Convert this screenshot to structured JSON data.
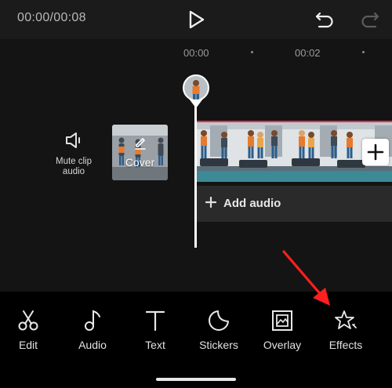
{
  "topbar": {
    "timecode": "00:00/00:08",
    "play_icon": "play-icon",
    "undo_icon": "undo-icon",
    "redo_icon": "redo-icon"
  },
  "ruler": {
    "marks": [
      "00:00",
      "00:02"
    ]
  },
  "track_area": {
    "mute_label": "Mute clip audio",
    "mute_icon": "speaker-icon",
    "cover_label": "Cover",
    "cover_icon": "pencil-icon",
    "add_clip_icon": "plus-icon",
    "add_audio_label": "Add audio"
  },
  "tools": [
    {
      "label": "Edit",
      "icon": "scissors-icon"
    },
    {
      "label": "Audio",
      "icon": "music-note-icon"
    },
    {
      "label": "Text",
      "icon": "text-icon"
    },
    {
      "label": "Stickers",
      "icon": "sticker-icon"
    },
    {
      "label": "Overlay",
      "icon": "overlay-icon"
    },
    {
      "label": "Effects",
      "icon": "effects-star-icon"
    }
  ],
  "colors": {
    "background": "#141414",
    "toolbar": "#1b1b1b",
    "bottom_bar": "#000000",
    "clip_border": "#e8304f",
    "annotation_arrow": "#ff1f1f"
  }
}
